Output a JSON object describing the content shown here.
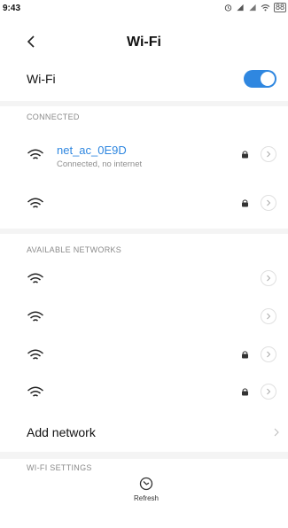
{
  "status_bar": {
    "time": "9:43",
    "battery": "88"
  },
  "header": {
    "title": "Wi-Fi"
  },
  "wifi_toggle": {
    "label": "Wi-Fi",
    "enabled": true
  },
  "connected_section": {
    "header": "CONNECTED",
    "networks": [
      {
        "name": "net_ac_0E9D",
        "status": "Connected, no internet",
        "locked": true
      },
      {
        "name": "",
        "status": "",
        "locked": true
      }
    ]
  },
  "available_section": {
    "header": "AVAILABLE NETWORKS",
    "networks": [
      {
        "locked": false
      },
      {
        "locked": false
      },
      {
        "locked": true
      },
      {
        "locked": true
      }
    ]
  },
  "add_network": {
    "label": "Add network"
  },
  "settings_section": {
    "header": "WI-FI SETTINGS"
  },
  "bottom": {
    "refresh_label": "Refresh"
  },
  "colors": {
    "accent": "#2f87e0",
    "separator": "#f4f4f4"
  },
  "icons": {
    "back": "chevron-left-icon",
    "wifi": "wifi-icon",
    "lock": "lock-icon",
    "chevron": "chevron-right-icon",
    "refresh": "refresh-icon"
  }
}
